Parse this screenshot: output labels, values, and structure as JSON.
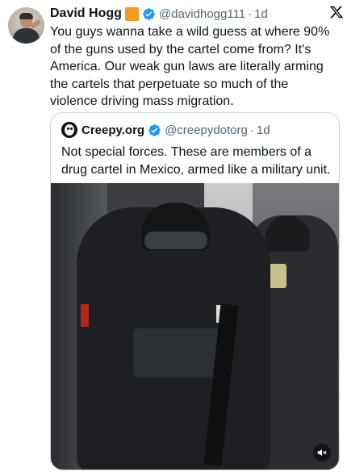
{
  "tweet": {
    "author_name": "David Hogg",
    "author_handle": "@davidhogg111",
    "separator": "·",
    "time": "1d",
    "text": "You guys wanna take a wild guess at where 90% of the guns used by the cartel come from? It's America. Our weak gun laws are literally arming the cartels that perpetuate so much of the violence driving mass migration."
  },
  "quote": {
    "author_name": "Creepy.org",
    "author_handle": "@creepydotorg",
    "separator": "·",
    "time": "1d",
    "text": "Not special forces. These are members of a drug cartel in Mexico, armed like a military unit."
  },
  "colors": {
    "verified": "#1d9bf0",
    "secondary_text": "#536471",
    "border": "#cfd9de",
    "badge_orange": "#f59a23"
  },
  "icons": [
    "avatar",
    "orange-square-emoji-icon",
    "verified-badge-icon",
    "x-logo-icon",
    "mute-icon"
  ]
}
